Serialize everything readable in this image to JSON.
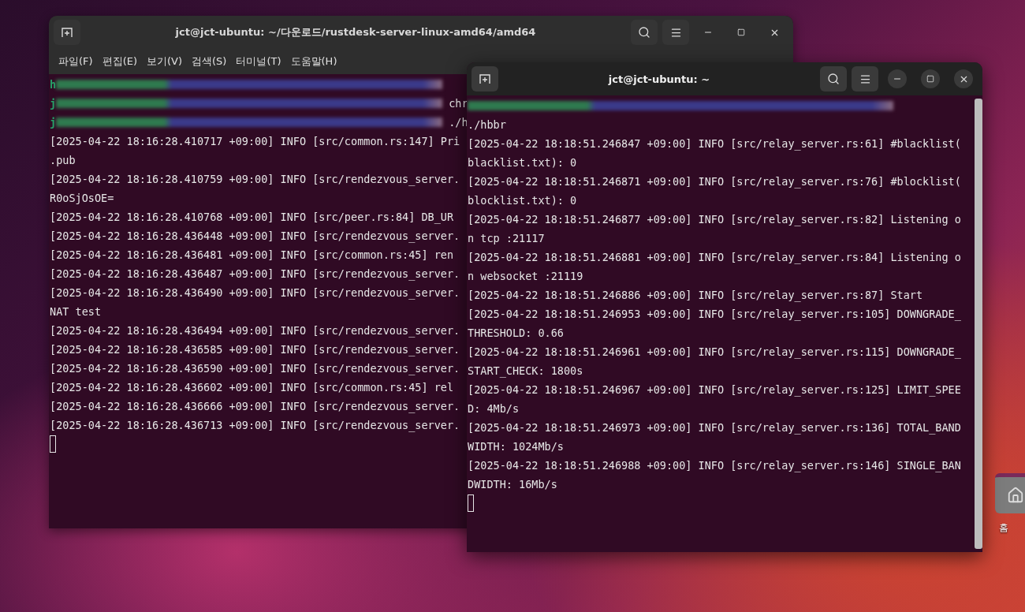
{
  "windows": [
    {
      "title": "jct@jct-ubuntu: ~/다운로드/rustdesk-server-linux-amd64/amd64",
      "active": false,
      "menu": [
        "파일(F)",
        "편집(E)",
        "보기(V)",
        "검색(S)",
        "터미널(T)",
        "도움말(H)"
      ],
      "lines": [
        {
          "kind": "redacted",
          "prefix": "h"
        },
        {
          "kind": "redacted",
          "prefix": "j",
          "suffix": "chr"
        },
        {
          "kind": "redacted",
          "prefix": "j",
          "suffix": "./h"
        },
        {
          "kind": "text",
          "text": "[2025-04-22 18:16:28.410717 +09:00] INFO [src/common.rs:147] Pri"
        },
        {
          "kind": "text",
          "text": ".pub"
        },
        {
          "kind": "text",
          "text": "[2025-04-22 18:16:28.410759 +09:00] INFO [src/rendezvous_server."
        },
        {
          "kind": "text",
          "text": "R0oSjOsOE="
        },
        {
          "kind": "text",
          "text": "[2025-04-22 18:16:28.410768 +09:00] INFO [src/peer.rs:84] DB_UR"
        },
        {
          "kind": "text",
          "text": "[2025-04-22 18:16:28.436448 +09:00] INFO [src/rendezvous_server."
        },
        {
          "kind": "text",
          "text": "[2025-04-22 18:16:28.436481 +09:00] INFO [src/common.rs:45] ren"
        },
        {
          "kind": "text",
          "text": "[2025-04-22 18:16:28.436487 +09:00] INFO [src/rendezvous_server."
        },
        {
          "kind": "text",
          "text": "[2025-04-22 18:16:28.436490 +09:00] INFO [src/rendezvous_server."
        },
        {
          "kind": "text",
          "text": "NAT test"
        },
        {
          "kind": "text",
          "text": "[2025-04-22 18:16:28.436494 +09:00] INFO [src/rendezvous_server."
        },
        {
          "kind": "text",
          "text": "[2025-04-22 18:16:28.436585 +09:00] INFO [src/rendezvous_server."
        },
        {
          "kind": "text",
          "text": "[2025-04-22 18:16:28.436590 +09:00] INFO [src/rendezvous_server."
        },
        {
          "kind": "text",
          "text": "[2025-04-22 18:16:28.436602 +09:00] INFO [src/common.rs:45] rel"
        },
        {
          "kind": "text",
          "text": "[2025-04-22 18:16:28.436666 +09:00] INFO [src/rendezvous_server."
        },
        {
          "kind": "text",
          "text": "[2025-04-22 18:16:28.436713 +09:00] INFO [src/rendezvous_server."
        }
      ]
    },
    {
      "title": "jct@jct-ubuntu: ~",
      "active": true,
      "lines": [
        {
          "kind": "redacted"
        },
        {
          "kind": "text",
          "text": "./hbbr"
        },
        {
          "kind": "text",
          "text": "[2025-04-22 18:18:51.246847 +09:00] INFO [src/relay_server.rs:61] #blacklist("
        },
        {
          "kind": "text",
          "text": "blacklist.txt): 0"
        },
        {
          "kind": "text",
          "text": "[2025-04-22 18:18:51.246871 +09:00] INFO [src/relay_server.rs:76] #blocklist("
        },
        {
          "kind": "text",
          "text": "blocklist.txt): 0"
        },
        {
          "kind": "text",
          "text": "[2025-04-22 18:18:51.246877 +09:00] INFO [src/relay_server.rs:82] Listening o"
        },
        {
          "kind": "text",
          "text": "n tcp :21117"
        },
        {
          "kind": "text",
          "text": "[2025-04-22 18:18:51.246881 +09:00] INFO [src/relay_server.rs:84] Listening o"
        },
        {
          "kind": "text",
          "text": "n websocket :21119"
        },
        {
          "kind": "text",
          "text": "[2025-04-22 18:18:51.246886 +09:00] INFO [src/relay_server.rs:87] Start"
        },
        {
          "kind": "text",
          "text": "[2025-04-22 18:18:51.246953 +09:00] INFO [src/relay_server.rs:105] DOWNGRADE_"
        },
        {
          "kind": "text",
          "text": "THRESHOLD: 0.66"
        },
        {
          "kind": "text",
          "text": "[2025-04-22 18:18:51.246961 +09:00] INFO [src/relay_server.rs:115] DOWNGRADE_"
        },
        {
          "kind": "text",
          "text": "START_CHECK: 1800s"
        },
        {
          "kind": "text",
          "text": "[2025-04-22 18:18:51.246967 +09:00] INFO [src/relay_server.rs:125] LIMIT_SPEE"
        },
        {
          "kind": "text",
          "text": "D: 4Mb/s"
        },
        {
          "kind": "text",
          "text": "[2025-04-22 18:18:51.246973 +09:00] INFO [src/relay_server.rs:136] TOTAL_BAND"
        },
        {
          "kind": "text",
          "text": "WIDTH: 1024Mb/s"
        },
        {
          "kind": "text",
          "text": "[2025-04-22 18:18:51.246988 +09:00] INFO [src/relay_server.rs:146] SINGLE_BAN"
        },
        {
          "kind": "text",
          "text": "DWIDTH: 16Mb/s"
        }
      ]
    }
  ],
  "desktop_icon": {
    "label": "홈"
  }
}
